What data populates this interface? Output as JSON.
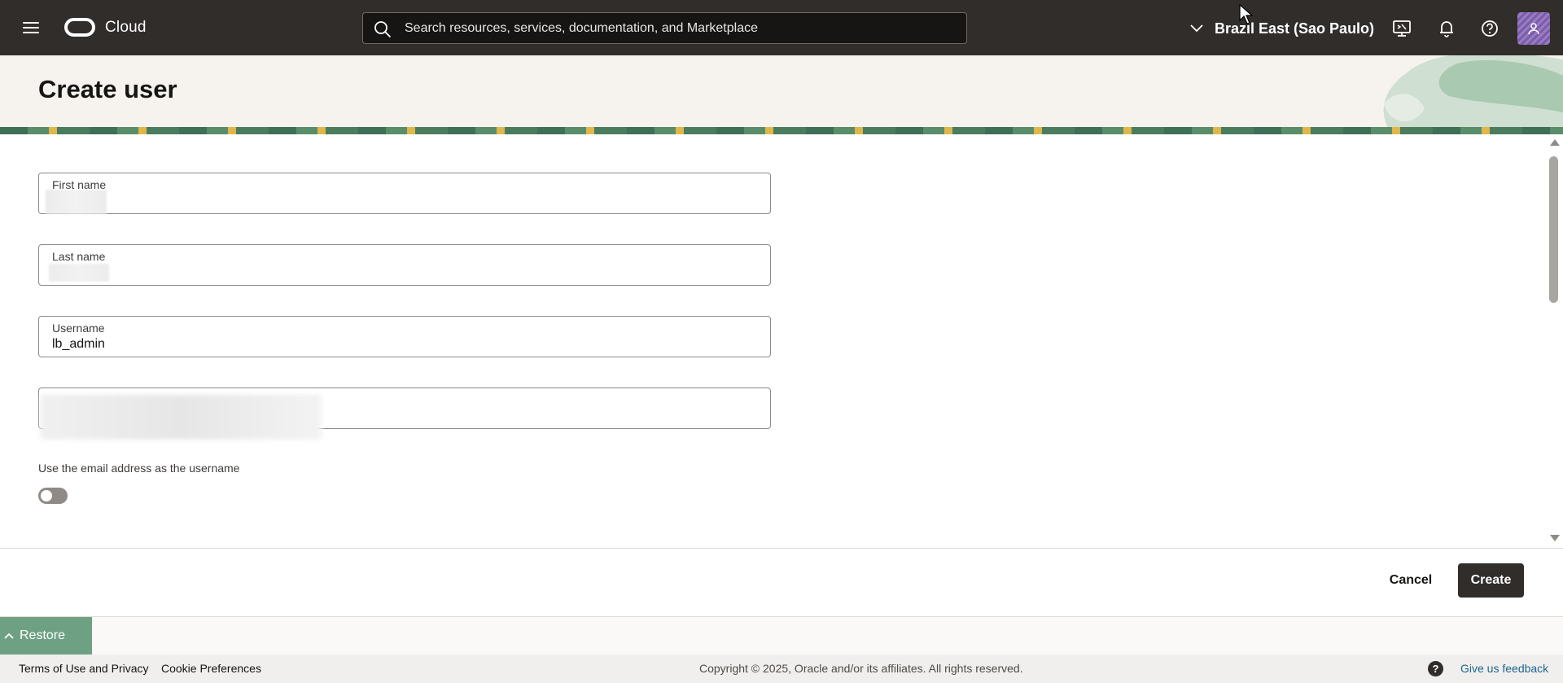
{
  "topbar": {
    "brand": "Cloud",
    "search_placeholder": "Search resources, services, documentation, and Marketplace",
    "region": "Brazil East (Sao Paulo)",
    "icons": [
      "menu-icon",
      "cloud-shell-icon",
      "bell-icon",
      "help-icon",
      "user-avatar"
    ]
  },
  "header": {
    "title": "Create user"
  },
  "form": {
    "first_name_label": "First name",
    "last_name_label": "Last name",
    "username_label": "Username",
    "username_value": "lb_admin",
    "toggle_caption": "Use the email address as the username",
    "toggle_state": false
  },
  "actions": {
    "cancel": "Cancel",
    "create": "Create"
  },
  "restore_label": "Restore",
  "footer": {
    "terms": "Terms of Use and Privacy",
    "cookies": "Cookie Preferences",
    "copyright": "Copyright © 2025, Oracle and/or its affiliates. All rights reserved.",
    "feedback": "Give us feedback",
    "help_badge": "?"
  },
  "colors": {
    "topbar": "#312d2a",
    "accent_green": "#6ea183",
    "primary_button": "#312d2a"
  }
}
